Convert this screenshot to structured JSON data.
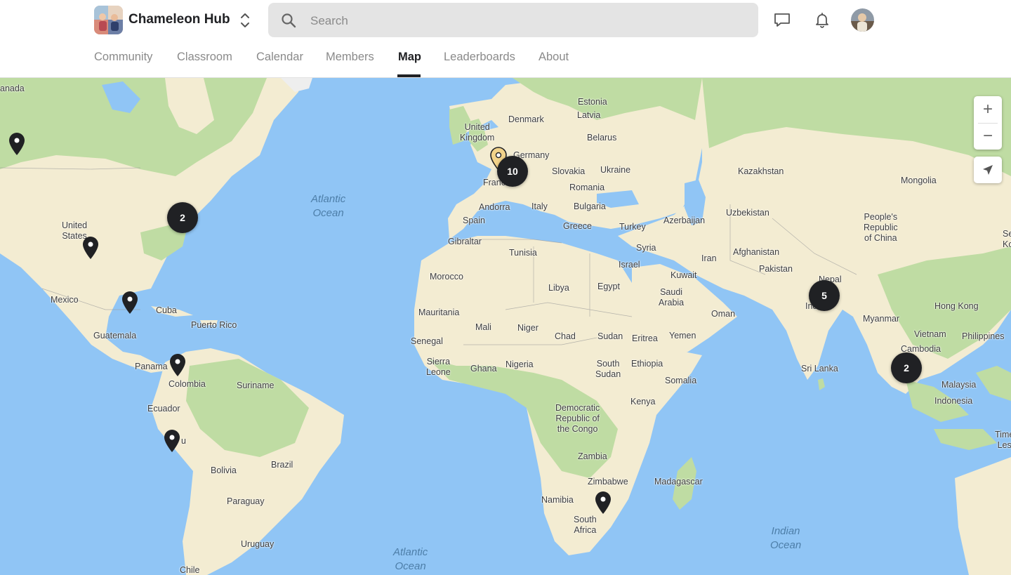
{
  "header": {
    "community_name": "Chameleon Hub",
    "search_placeholder": "Search"
  },
  "tabs": [
    {
      "label": "Community"
    },
    {
      "label": "Classroom"
    },
    {
      "label": "Calendar"
    },
    {
      "label": "Members"
    },
    {
      "label": "Map"
    },
    {
      "label": "Leaderboards"
    },
    {
      "label": "About"
    }
  ],
  "active_tab": "Map",
  "map": {
    "oceans": {
      "atlantic_north": "Atlantic\nOcean",
      "atlantic_south": "Atlantic\nOcean",
      "indian": "Indian\nOcean"
    },
    "labels": {
      "canada": "anada",
      "united_states": "United\nStates",
      "mexico": "Mexico",
      "cuba": "Cuba",
      "puerto_rico": "Puerto Rico",
      "guatemala": "Guatemala",
      "panama": "Panama",
      "colombia": "Colombia",
      "suriname": "Suriname",
      "ecuador": "Ecuador",
      "peru": "u",
      "bolivia": "Bolivia",
      "brazil": "Brazil",
      "paraguay": "Paraguay",
      "uruguay": "Uruguay",
      "chile": "Chile",
      "united_kingdom": "United\nKingdom",
      "denmark": "Denmark",
      "estonia": "Estonia",
      "latvia": "Latvia",
      "belarus": "Belarus",
      "germany": "Germany",
      "slovakia": "Slovakia",
      "ukraine": "Ukraine",
      "romania": "Romania",
      "bulgaria": "Bulgaria",
      "france": "France",
      "andorra": "Andorra",
      "italy": "Italy",
      "spain": "Spain",
      "greece": "Greece",
      "turkey": "Turkey",
      "gibraltar": "Gibraltar",
      "tunisia": "Tunisia",
      "morocco": "Morocco",
      "libya": "Libya",
      "egypt": "Egypt",
      "syria": "Syria",
      "israel": "Israel",
      "kuwait": "Kuwait",
      "iran": "Iran",
      "saudi_arabia": "Saudi\nArabia",
      "oman": "Oman",
      "yemen": "Yemen",
      "mauritania": "Mauritania",
      "mali": "Mali",
      "niger": "Niger",
      "chad": "Chad",
      "sudan": "Sudan",
      "eritrea": "Eritrea",
      "senegal": "Senegal",
      "sierra_leone": "Sierra\nLeone",
      "ghana": "Ghana",
      "nigeria": "Nigeria",
      "south_sudan": "South\nSudan",
      "ethiopia": "Ethiopia",
      "somalia": "Somalia",
      "kenya": "Kenya",
      "drc": "Democratic\nRepublic of\nthe Congo",
      "zambia": "Zambia",
      "zimbabwe": "Zimbabwe",
      "namibia": "Namibia",
      "madagascar": "Madagascar",
      "south_africa": "South\nAfrica",
      "kazakhstan": "Kazakhstan",
      "uzbekistan": "Uzbekistan",
      "azerbaijan": "Azerbaijan",
      "afghanistan": "Afghanistan",
      "pakistan": "Pakistan",
      "nepal": "Nepal",
      "india": "India",
      "sri_lanka": "Sri Lanka",
      "mongolia": "Mongolia",
      "china": "People's\nRepublic\nof China",
      "hong_kong": "Hong Kong",
      "myanmar": "Myanmar",
      "vietnam": "Vietnam",
      "cambodia": "Cambodia",
      "philippines": "Philippines",
      "malaysia": "Malaysia",
      "indonesia": "Indonesia",
      "timor_leste": "Time\nLes",
      "se_edge": "Se\nKo"
    },
    "clusters": [
      {
        "count": "2",
        "location": "US East Coast"
      },
      {
        "count": "10",
        "location": "France / Switzerland"
      },
      {
        "count": "5",
        "location": "India"
      },
      {
        "count": "2",
        "location": "Southeast Asia"
      }
    ],
    "pins": [
      {
        "location": "Western Canada",
        "color": "#202124"
      },
      {
        "location": "United States",
        "color": "#202124"
      },
      {
        "location": "Yucatan",
        "color": "#202124"
      },
      {
        "location": "Panama",
        "color": "#202124"
      },
      {
        "location": "Peru",
        "color": "#202124"
      },
      {
        "location": "South Africa",
        "color": "#202124"
      },
      {
        "location": "France (highlighted)",
        "color": "#f2d38a"
      }
    ],
    "controls": {
      "zoom_in": "+",
      "zoom_out": "−"
    },
    "colors": {
      "water": "#90c5f5",
      "land": "#f5efd8",
      "vegetation": "#bfdca3",
      "marker": "#202124",
      "highlight_marker": "#f2d38a"
    }
  }
}
